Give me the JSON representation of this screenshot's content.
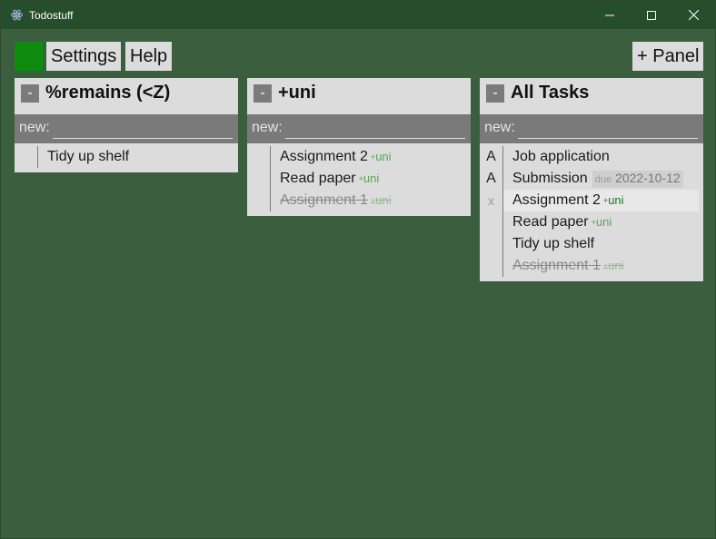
{
  "window": {
    "title": "Todostuff",
    "icon": "electron-atom-icon",
    "colors": {
      "background": "#3b5e3e",
      "titlebar": "#264d2c",
      "status": "#0d8c10"
    }
  },
  "toolbar": {
    "settings_label": "Settings",
    "help_label": "Help",
    "add_panel_label": "+ Panel"
  },
  "panels": [
    {
      "collapse_label": "-",
      "title": "%remains (<Z)",
      "new_label": "new:",
      "new_value": "",
      "tasks": [
        {
          "marker": "",
          "text": "Tidy up shelf",
          "tag": "",
          "completed": false
        }
      ]
    },
    {
      "collapse_label": "-",
      "title": "+uni",
      "new_label": "new:",
      "new_value": "",
      "tasks": [
        {
          "marker": "",
          "text": "Assignment 2",
          "tag": "uni",
          "completed": false
        },
        {
          "marker": "",
          "text": "Read paper",
          "tag": "uni",
          "completed": false
        },
        {
          "marker": "",
          "text": "Assignment 1",
          "tag": "uni",
          "completed": true
        }
      ]
    },
    {
      "collapse_label": "-",
      "title": "All Tasks",
      "new_label": "new:",
      "new_value": "",
      "tasks": [
        {
          "marker": "A",
          "text": "Job application",
          "tag": "",
          "completed": false
        },
        {
          "marker": "A",
          "text": "Submission",
          "tag": "",
          "due_label": "due",
          "due_date": "2022-10-12",
          "completed": false
        },
        {
          "marker": "x",
          "text": "Assignment 2",
          "tag": "uni",
          "completed": false,
          "hover": true
        },
        {
          "marker": "",
          "text": "Read paper",
          "tag": "uni",
          "completed": false
        },
        {
          "marker": "",
          "text": "Tidy up shelf",
          "tag": "",
          "completed": false
        },
        {
          "marker": "",
          "text": "Assignment 1",
          "tag": "uni",
          "completed": true
        }
      ]
    }
  ]
}
